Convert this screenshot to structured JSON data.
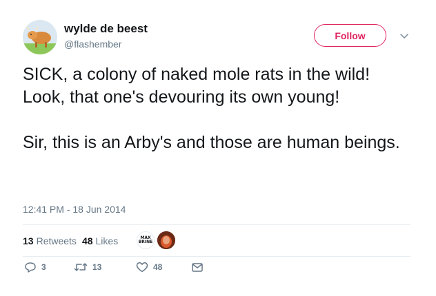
{
  "user": {
    "name": "wylde de beest",
    "handle": "@flashember"
  },
  "follow_label": "Follow",
  "tweet": {
    "text": "SICK, a colony of naked mole rats in the wild! Look, that one's devouring its own young!\n\nSir, this is an Arby's and those are human beings.",
    "timestamp": "12:41 PM - 18 Jun 2014"
  },
  "stats": {
    "retweets_count": "13",
    "retweets_label": "Retweets",
    "likes_count": "48",
    "likes_label": "Likes"
  },
  "likers": {
    "first_label": "MAX\nBRINE"
  },
  "actions": {
    "reply_count": "3",
    "retweet_count": "13",
    "like_count": "48"
  },
  "colors": {
    "accent": "#e0245e",
    "secondary_text": "#657786",
    "primary_text": "#14171a",
    "divider": "#e6ecf0"
  }
}
